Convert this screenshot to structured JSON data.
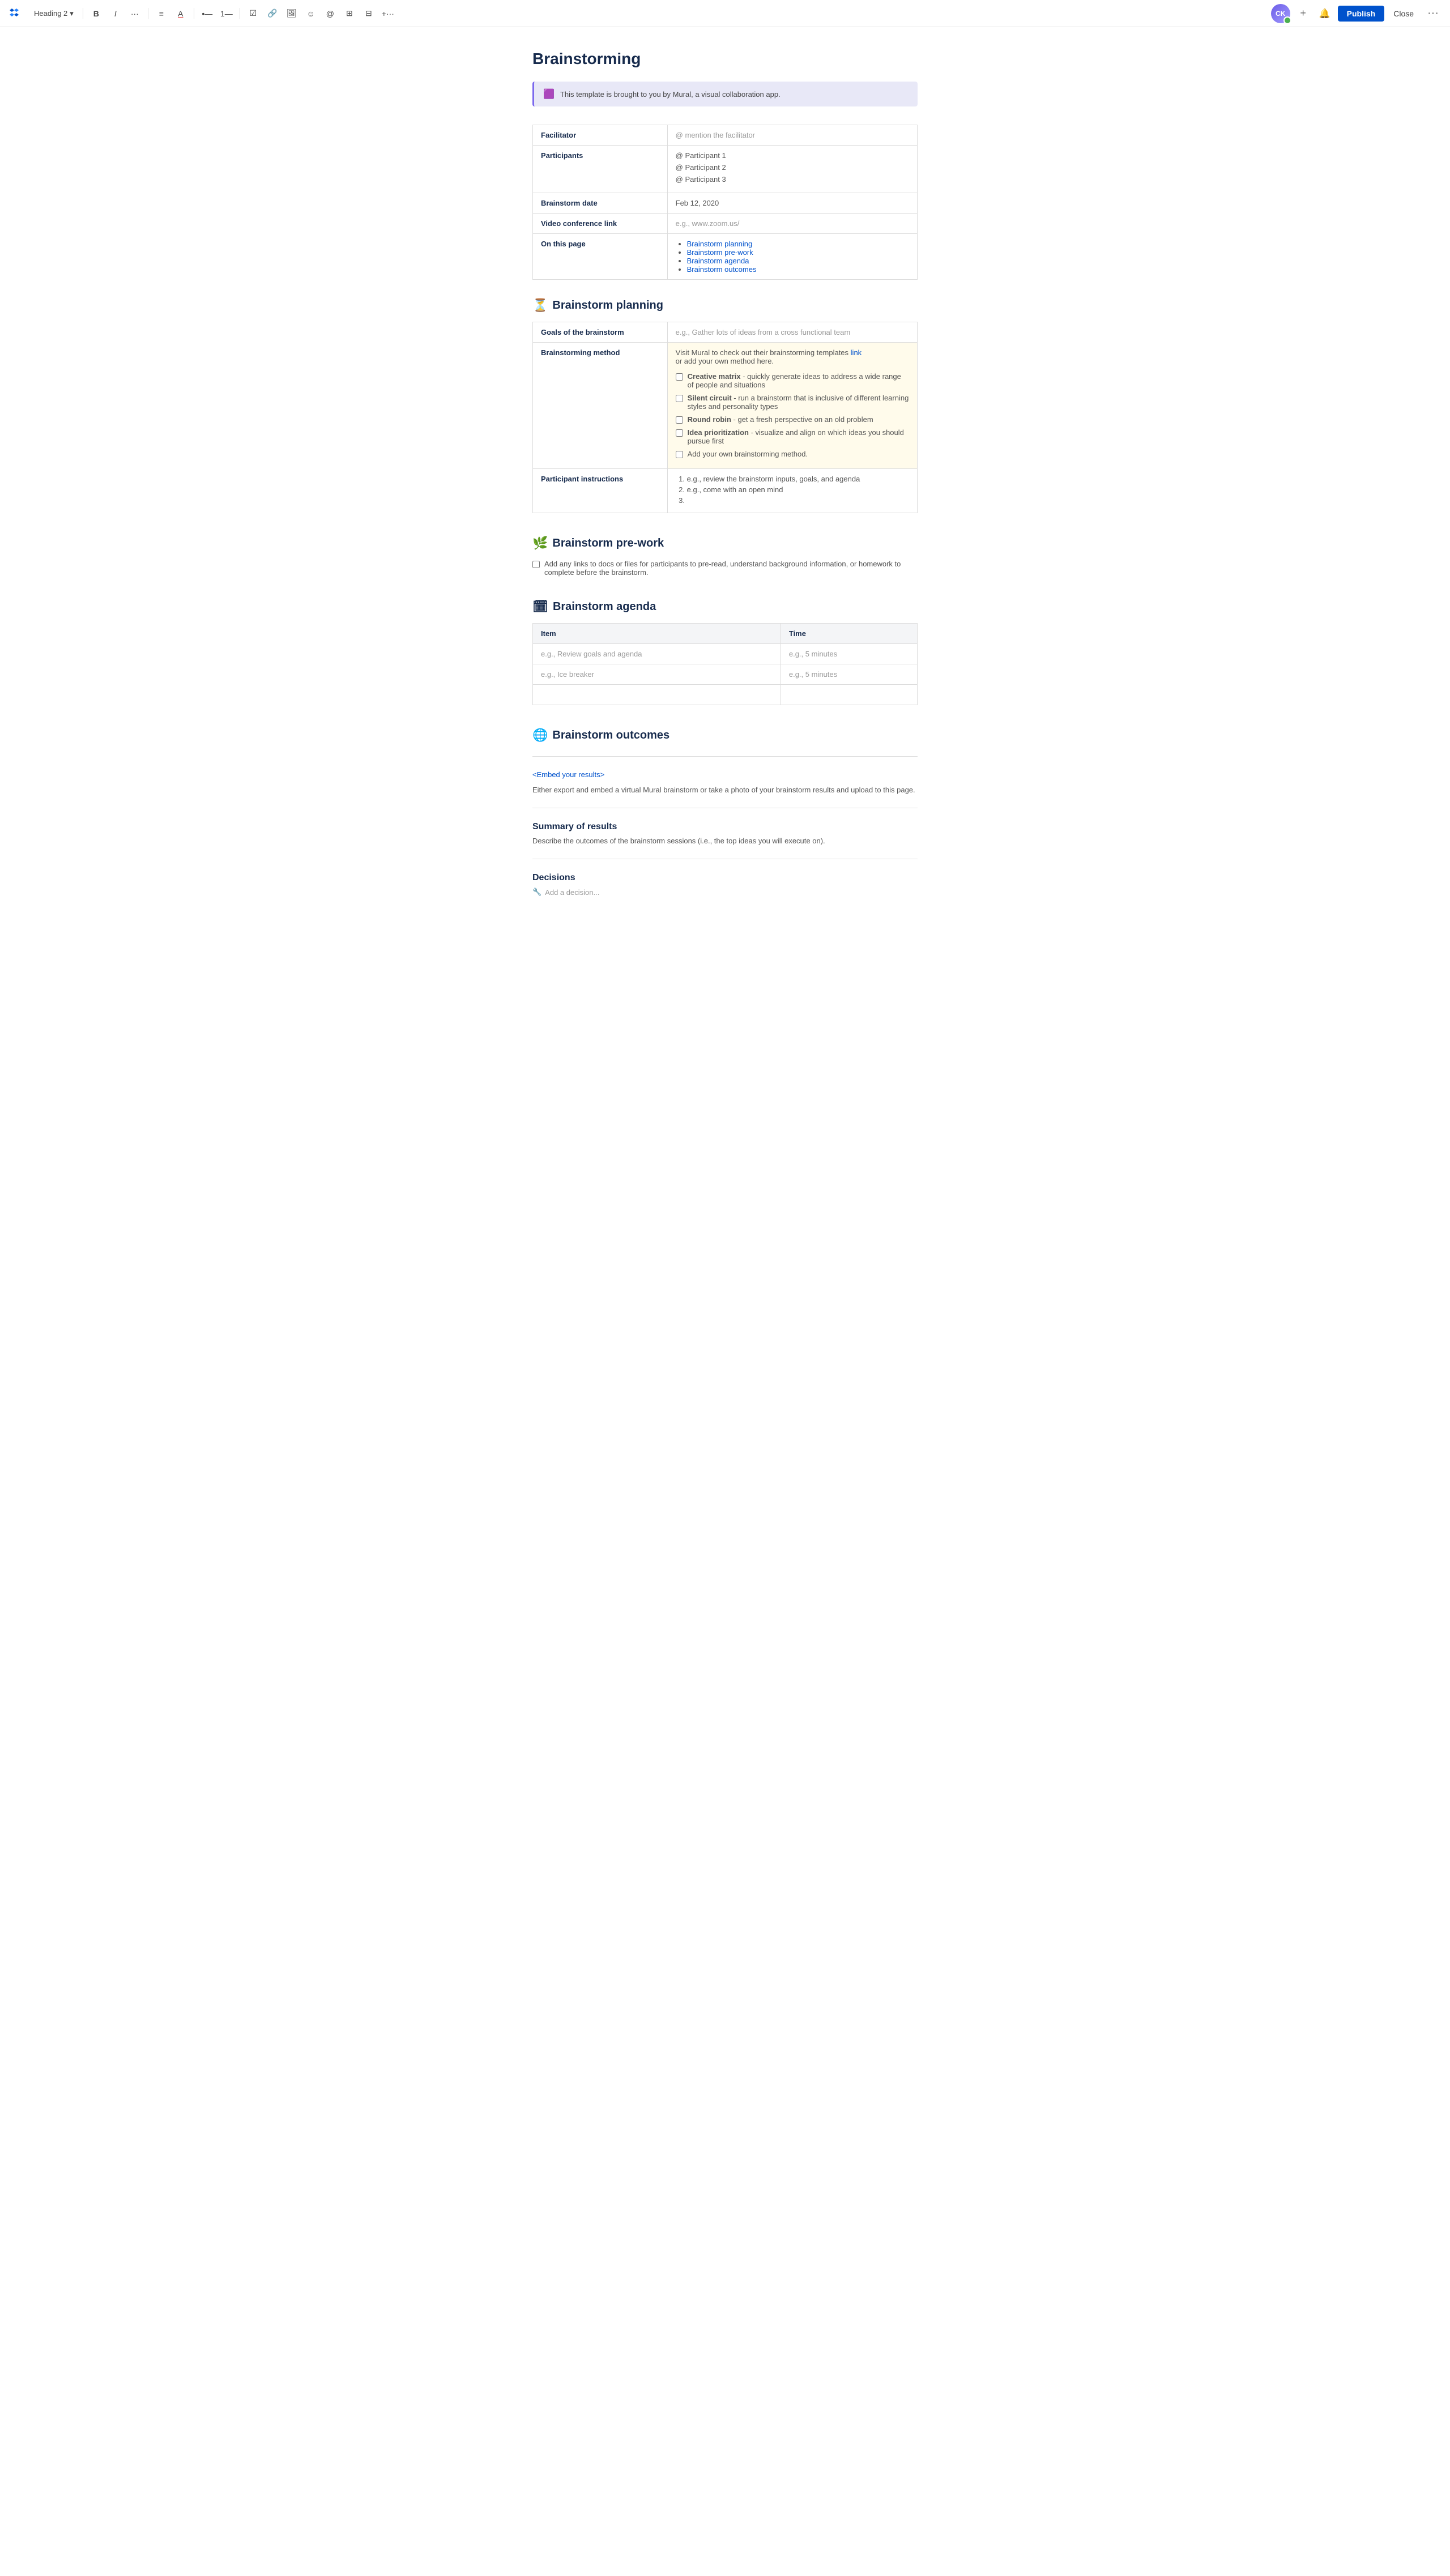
{
  "toolbar": {
    "logo_label": "Confluence",
    "heading_selector": "Heading 2",
    "bold_label": "B",
    "italic_label": "I",
    "ellipsis_label": "···",
    "align_label": "≡",
    "color_label": "A",
    "bullet_label": "•",
    "number_label": "#",
    "task_label": "☑",
    "link_label": "🔗",
    "image_label": "🖼",
    "emoji_label": "☺",
    "mention_label": "@",
    "table_label": "⊞",
    "layout_label": "⊟",
    "more_label": "+",
    "avatar_initials": "CK",
    "plus_label": "+",
    "notification_label": "🔔",
    "publish_label": "Publish",
    "close_label": "Close",
    "more_options_label": "···"
  },
  "page": {
    "title": "Brainstorming",
    "banner_text": "This template is brought to you by Mural, a visual collaboration app."
  },
  "info_table": {
    "rows": [
      {
        "label": "Facilitator",
        "value": "@ mention the facilitator"
      },
      {
        "label": "Participants",
        "value": ""
      },
      {
        "label": "Brainstorm date",
        "value": "Feb 12, 2020"
      },
      {
        "label": "Video conference link",
        "value": "e.g., www.zoom.us/"
      },
      {
        "label": "On this page",
        "value": ""
      }
    ],
    "participants": [
      "@ Participant 1",
      "@ Participant 2",
      "@ Participant 3"
    ],
    "on_this_page_links": [
      "Brainstorm planning",
      "Brainstorm pre-work",
      "Brainstorm agenda",
      "Brainstorm outcomes"
    ]
  },
  "planning": {
    "section_emoji": "⏳",
    "section_title": "Brainstorm planning",
    "goals_label": "Goals of the brainstorm",
    "goals_placeholder": "e.g., Gather lots of ideas from a cross functional team",
    "method_label": "Brainstorming method",
    "method_intro": "Visit Mural to check out their brainstorming templates",
    "method_link_text": "link",
    "method_or": "or add your own method here.",
    "methods": [
      {
        "name": "Creative matrix",
        "desc": "- quickly generate ideas to address a wide range of people and situations"
      },
      {
        "name": "Silent circuit",
        "desc": "- run a brainstorm that is inclusive of different learning styles and personality types"
      },
      {
        "name": "Round robin",
        "desc": "- get a fresh perspective on an old problem"
      },
      {
        "name": "Idea prioritization",
        "desc": "- visualize and align on which ideas you should pursue first"
      },
      {
        "name": "Add your own",
        "desc": "brainstorming method."
      }
    ],
    "instructions_label": "Participant instructions",
    "instructions": [
      "e.g., review the brainstorm inputs, goals, and agenda",
      "e.g., come with an open mind",
      ""
    ]
  },
  "prework": {
    "section_emoji": "🌿",
    "section_title": "Brainstorm pre-work",
    "checkbox_text": "Add any links to docs or files for participants to pre-read, understand background information, or homework to complete before the brainstorm."
  },
  "agenda": {
    "section_emoji": "🗓",
    "section_title": "Brainstorm agenda",
    "columns": [
      "Item",
      "Time"
    ],
    "rows": [
      {
        "item": "e.g., Review goals and agenda",
        "time": "e.g., 5 minutes"
      },
      {
        "item": "e.g., Ice breaker",
        "time": "e.g., 5 minutes"
      },
      {
        "item": "",
        "time": ""
      }
    ]
  },
  "outcomes": {
    "section_emoji": "🌐",
    "section_title": "Brainstorm outcomes",
    "embed_link_text": "<Embed your results>",
    "embed_desc": "Either export and embed a virtual Mural brainstorm or take a photo of your brainstorm results and upload to this page.",
    "summary_title": "Summary of results",
    "summary_desc": "Describe the outcomes of the brainstorm sessions (i.e., the top ideas you will execute on).",
    "decisions_title": "Decisions",
    "add_decision_text": "Add a decision..."
  }
}
